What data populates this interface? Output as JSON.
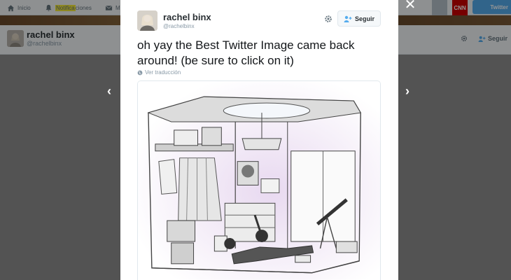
{
  "topbar": {
    "home_label": "Inicio",
    "notif_label_pre": "",
    "notif_label_hl": "Notifica",
    "notif_label_post": "ciones",
    "msg_label": "M",
    "cnn_label": "CNN",
    "tweet_label": "Twitter"
  },
  "background_profile": {
    "name": "rachel binx",
    "handle": "@rachelbinx",
    "follow_label": "Seguir"
  },
  "modal": {
    "close_glyph": "✕",
    "prev_glyph": "‹",
    "next_glyph": "›",
    "name": "rachel binx",
    "handle": "@rachelbinx",
    "follow_label": "Seguir",
    "tweet_text": "oh yay the Best Twitter Image came back around! (be sure to click on it)",
    "translate_label": "Ver traducción"
  },
  "icons": {
    "home": "home-icon",
    "notifications": "bell-icon",
    "gear": "gear-icon",
    "follow": "add-user-icon",
    "globe": "globe-icon"
  },
  "colors": {
    "highlight": "#f4ea3a",
    "twitter_blue": "#55acee",
    "cnn_red": "#cc0000"
  }
}
